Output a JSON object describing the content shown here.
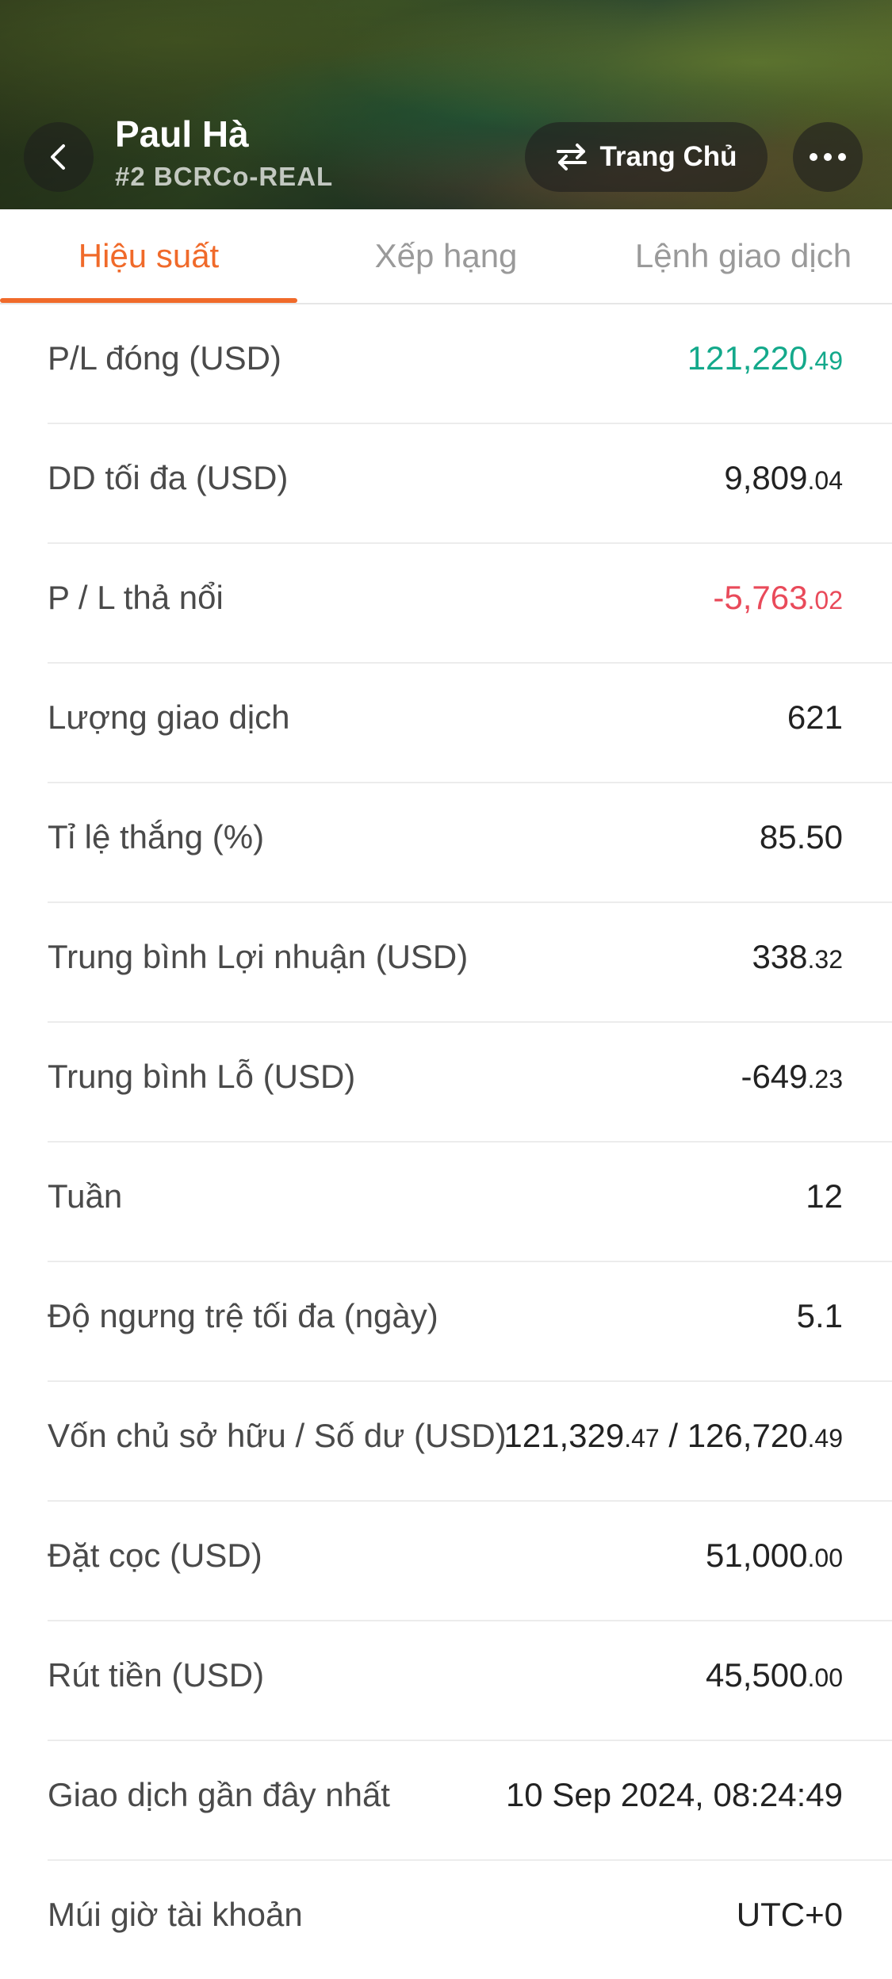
{
  "header": {
    "name": "Paul Hà",
    "account": "#2 BCRCo-REAL",
    "home_label": "Trang Chủ"
  },
  "tabs": [
    {
      "label": "Hiệu suất",
      "active": true
    },
    {
      "label": "Xếp hạng",
      "active": false
    },
    {
      "label": "Lệnh giao dịch",
      "active": false
    }
  ],
  "colors": {
    "accent": "#f06a2a",
    "positive": "#14a98b",
    "negative": "#e94a5a"
  },
  "rows": [
    {
      "label": "P/L đóng (USD)",
      "int": "121,220",
      "dec": ".49",
      "tone": "positive"
    },
    {
      "label": "DD tối đa (USD)",
      "int": "9,809",
      "dec": ".04",
      "tone": "normal"
    },
    {
      "label": "P / L thả nổi",
      "int": "-5,763",
      "dec": ".02",
      "tone": "negative"
    },
    {
      "label": "Lượng giao dịch",
      "int": "621",
      "dec": "",
      "tone": "normal"
    },
    {
      "label": "Tỉ lệ thắng (%)",
      "int": "85.50",
      "dec": "",
      "tone": "normal"
    },
    {
      "label": "Trung bình Lợi nhuận (USD)",
      "int": "338",
      "dec": ".32",
      "tone": "normal"
    },
    {
      "label": "Trung bình Lỗ (USD)",
      "int": "-649",
      "dec": ".23",
      "tone": "normal"
    },
    {
      "label": "Tuần",
      "int": "12",
      "dec": "",
      "tone": "normal"
    },
    {
      "label": "Độ ngưng trệ tối đa (ngày)",
      "int": "5.1",
      "dec": "",
      "tone": "normal"
    },
    {
      "label": "Vốn chủ sở hữu / Số dư (USD)",
      "int": "121,329",
      "dec": ".47",
      "int2": " / 126,720",
      "dec2": ".49",
      "tone": "normal"
    },
    {
      "label": "Đặt cọc (USD)",
      "int": "51,000",
      "dec": ".00",
      "tone": "normal"
    },
    {
      "label": "Rút tiền (USD)",
      "int": "45,500",
      "dec": ".00",
      "tone": "normal"
    },
    {
      "label": "Giao dịch gần đây nhất",
      "int": "10 Sep 2024, 08:24:49",
      "dec": "",
      "tone": "normal"
    },
    {
      "label": "Múi giờ tài khoản",
      "int": "UTC+0",
      "dec": "",
      "tone": "normal"
    }
  ]
}
